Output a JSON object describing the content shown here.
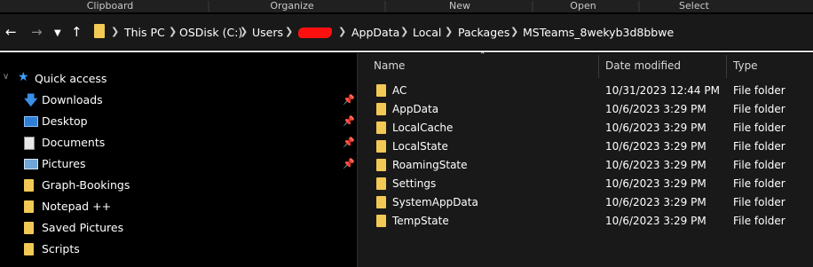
{
  "ribbon": {
    "groups": [
      "Clipboard",
      "Organize",
      "New",
      "Open",
      "Select"
    ]
  },
  "nav": {
    "back_icon": "arrow-left",
    "forward_icon": "arrow-right",
    "recent_icon": "chevron-down",
    "up_icon": "arrow-up"
  },
  "address": {
    "crumbs": [
      "This PC",
      "OSDisk (C:)",
      "Users",
      "AppData",
      "Local",
      "Packages",
      "MSTeams_8wekyb3d8bbwe"
    ],
    "redacted": true
  },
  "sidebar": {
    "quick_access": "Quick access",
    "items": [
      {
        "label": "Downloads",
        "icon": "download-icon",
        "pinned": true
      },
      {
        "label": "Desktop",
        "icon": "desktop-icon",
        "pinned": true
      },
      {
        "label": "Documents",
        "icon": "documents-icon",
        "pinned": true
      },
      {
        "label": "Pictures",
        "icon": "pictures-icon",
        "pinned": true
      },
      {
        "label": "Graph-Bookings",
        "icon": "folder-icon",
        "pinned": false
      },
      {
        "label": "Notepad ++",
        "icon": "folder-icon",
        "pinned": false
      },
      {
        "label": "Saved Pictures",
        "icon": "folder-icon",
        "pinned": false
      },
      {
        "label": "Scripts",
        "icon": "folder-icon",
        "pinned": false
      }
    ]
  },
  "columns": {
    "name": "Name",
    "date": "Date modified",
    "type": "Type"
  },
  "files": [
    {
      "name": "AC",
      "date": "10/31/2023 12:44 PM",
      "type": "File folder"
    },
    {
      "name": "AppData",
      "date": "10/6/2023 3:29 PM",
      "type": "File folder"
    },
    {
      "name": "LocalCache",
      "date": "10/6/2023 3:29 PM",
      "type": "File folder"
    },
    {
      "name": "LocalState",
      "date": "10/6/2023 3:29 PM",
      "type": "File folder"
    },
    {
      "name": "RoamingState",
      "date": "10/6/2023 3:29 PM",
      "type": "File folder"
    },
    {
      "name": "Settings",
      "date": "10/6/2023 3:29 PM",
      "type": "File folder"
    },
    {
      "name": "SystemAppData",
      "date": "10/6/2023 3:29 PM",
      "type": "File folder"
    },
    {
      "name": "TempState",
      "date": "10/6/2023 3:29 PM",
      "type": "File folder"
    }
  ],
  "colors": {
    "folder": "#f3c955",
    "accent": "#3ea0ff",
    "redaction": "#ff1010"
  }
}
